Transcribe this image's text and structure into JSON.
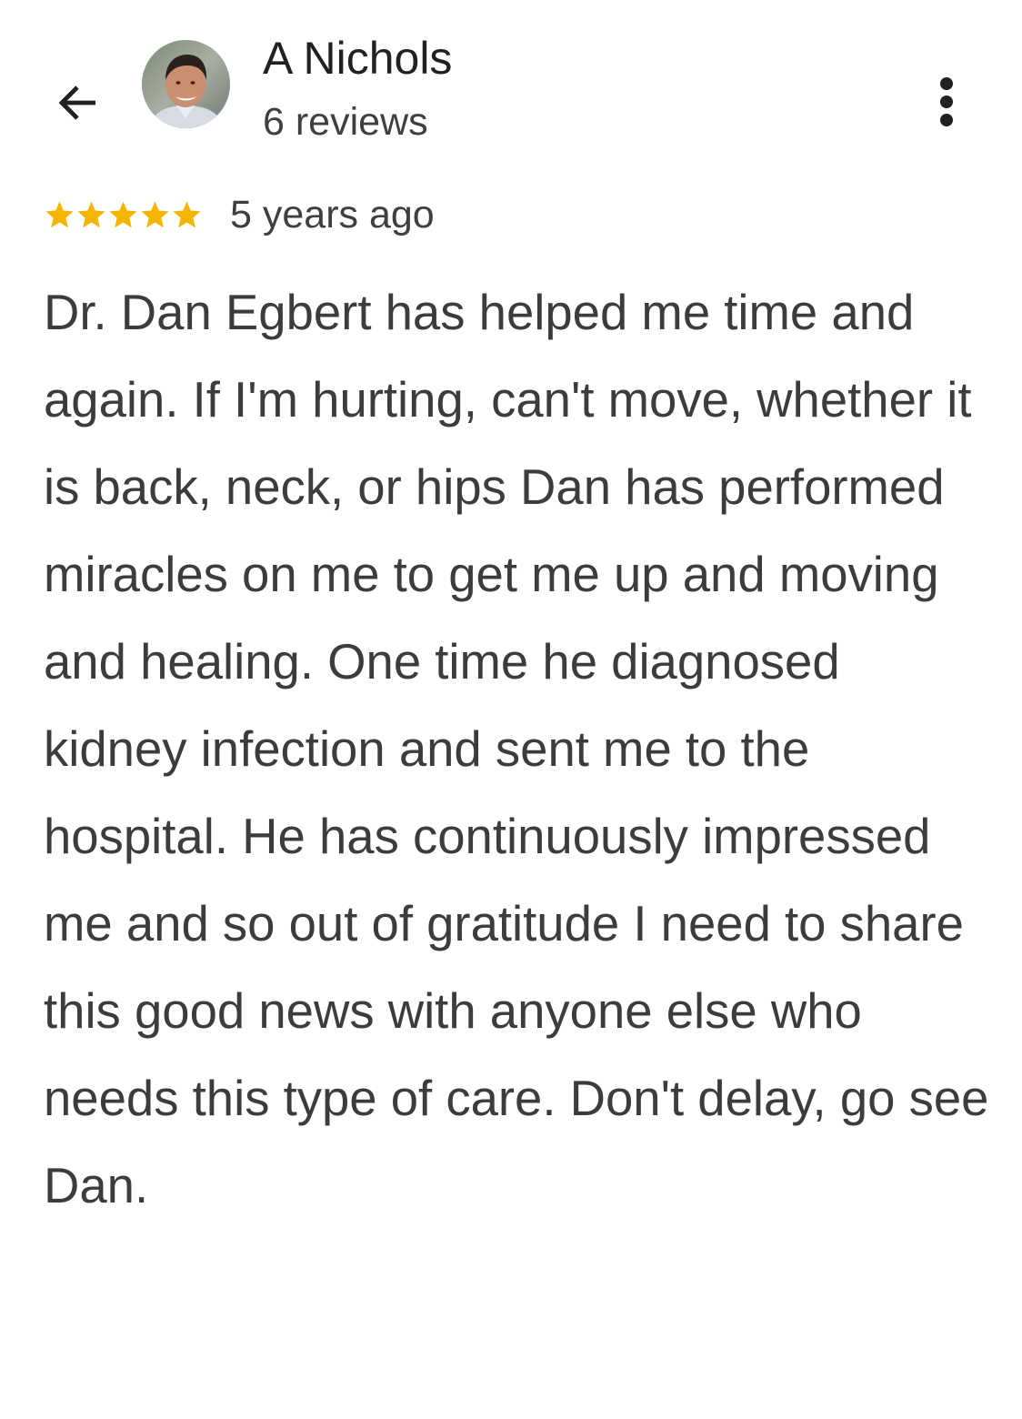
{
  "header": {
    "back_label": "Back",
    "reviewer_name": "A Nichols",
    "review_count": "6 reviews",
    "more_label": "More options"
  },
  "review": {
    "rating": 5,
    "rating_max": 5,
    "star_color": "#f4b400",
    "time": "5 years ago",
    "text": "Dr. Dan Egbert has helped me time and again. If I'm hurting, can't move, whether it is back, neck, or hips Dan has performed miracles on me to get me up and moving and healing. One time he diagnosed kidney infection and sent me to the hospital. He has continuously impressed me and so out of gratitude I need to share this good news with anyone else who needs this type of care. Don't delay, go see Dan."
  },
  "icons": {
    "back": "arrow-left-icon",
    "more": "more-vert-icon",
    "star": "star-icon"
  }
}
